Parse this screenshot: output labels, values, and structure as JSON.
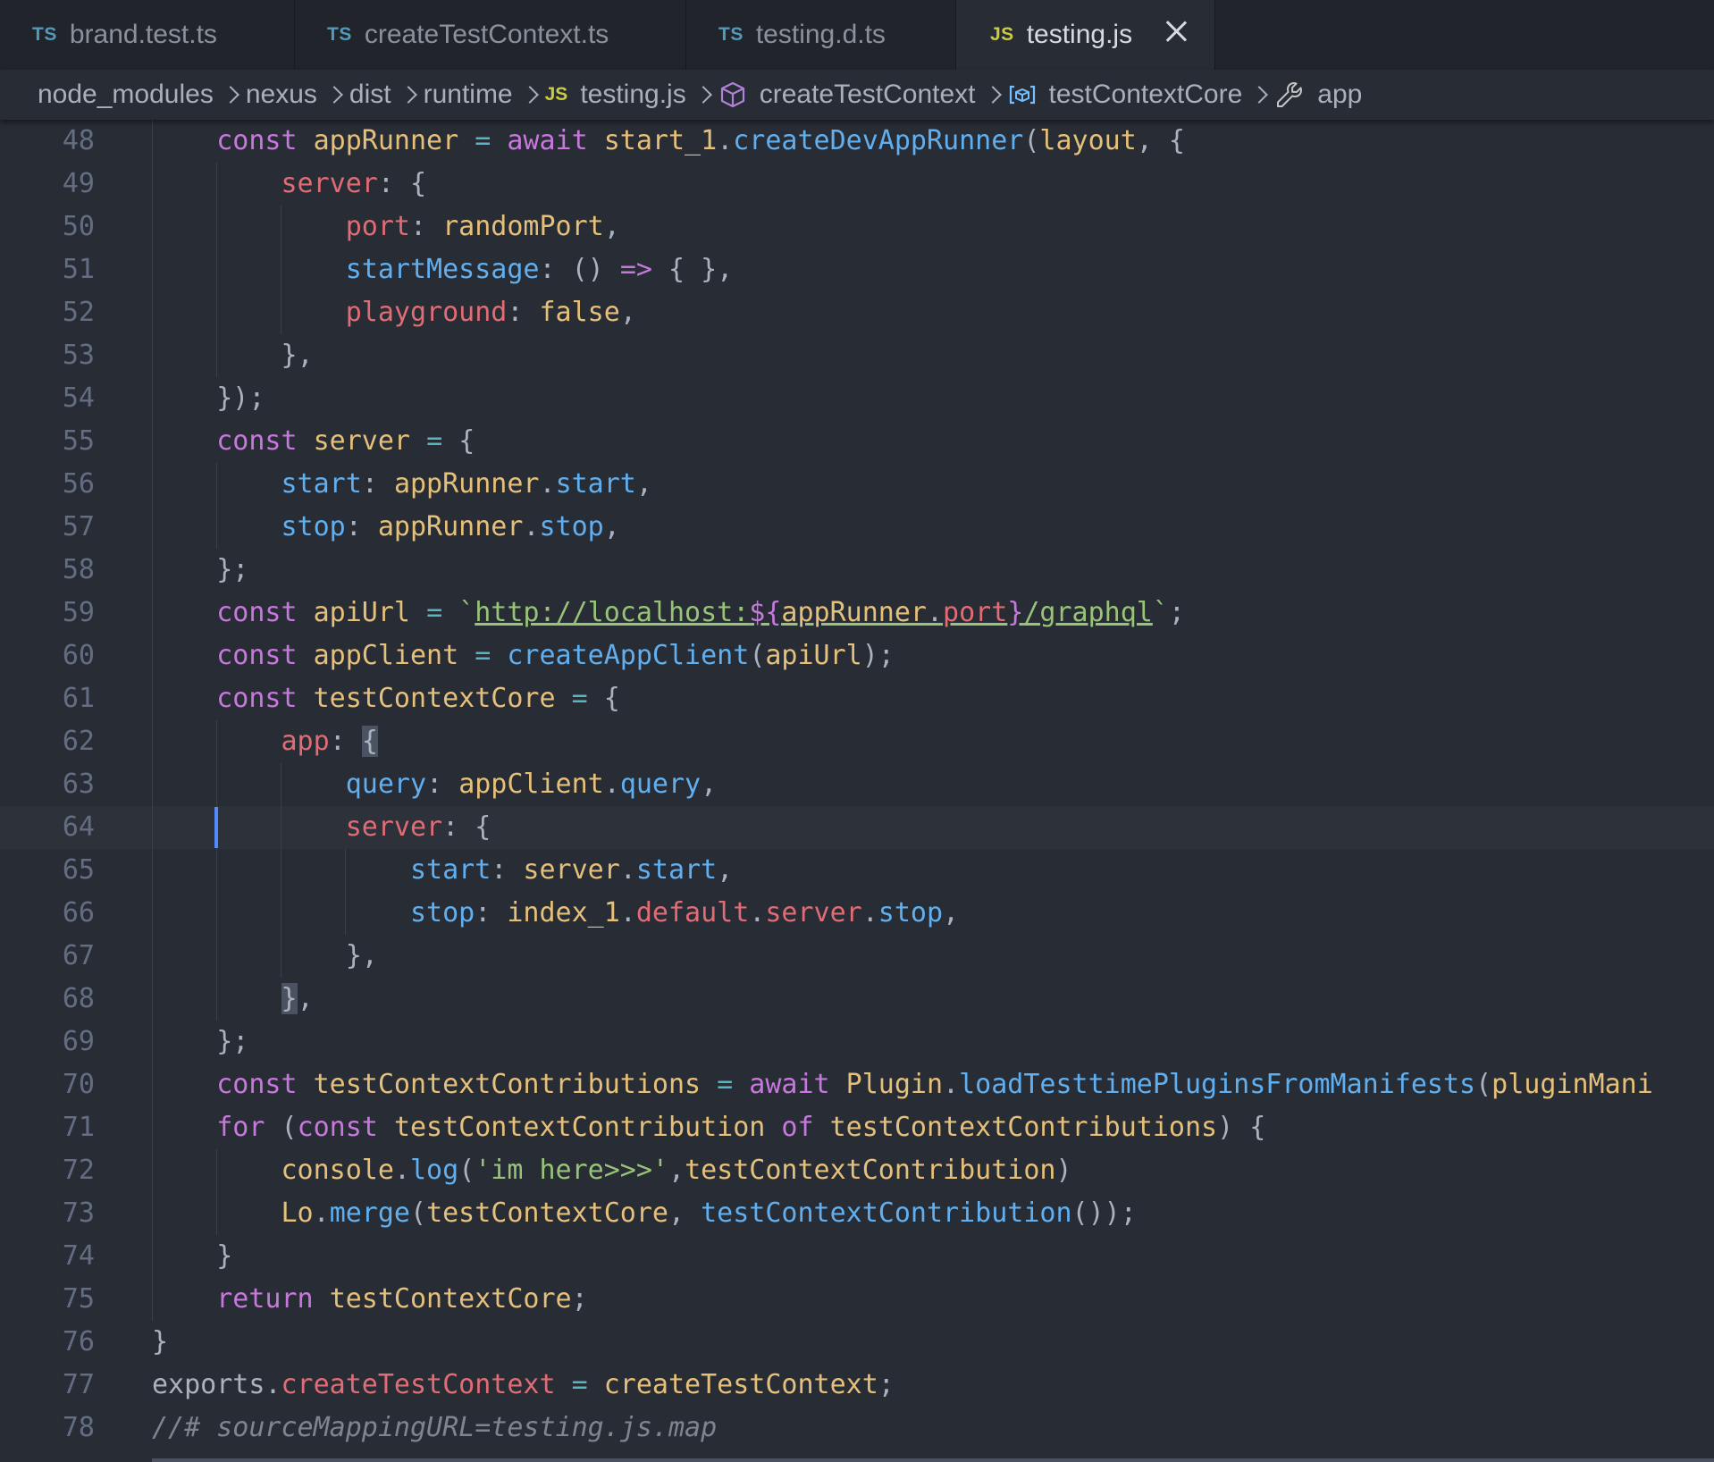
{
  "tabs": [
    {
      "type": "TS",
      "name": "brand.test.ts",
      "active": false
    },
    {
      "type": "TS",
      "name": "createTestContext.ts",
      "active": false
    },
    {
      "type": "TS",
      "name": "testing.d.ts",
      "active": false
    },
    {
      "type": "JS",
      "name": "testing.js",
      "active": true
    }
  ],
  "breadcrumb": {
    "items": [
      "node_modules",
      "nexus",
      "dist",
      "runtime",
      "testing.js",
      "createTestContext",
      "testContextCore",
      "app"
    ],
    "file_icon": "JS"
  },
  "editor": {
    "language": "javascript",
    "current_line": 64,
    "line_numbers": [
      "48",
      "49",
      "50",
      "51",
      "52",
      "53",
      "54",
      "55",
      "56",
      "57",
      "58",
      "59",
      "60",
      "61",
      "62",
      "63",
      "64",
      "65",
      "66",
      "67",
      "68",
      "69",
      "70",
      "71",
      "72",
      "73",
      "74",
      "75",
      "76",
      "77",
      "78"
    ],
    "lines": [
      "    const appRunner = await start_1.createDevAppRunner(layout, {",
      "        server: {",
      "            port: randomPort,",
      "            startMessage: () => { },",
      "            playground: false,",
      "        },",
      "    });",
      "    const server = {",
      "        start: appRunner.start,",
      "        stop: appRunner.stop,",
      "    };",
      "    const apiUrl = `http://localhost:${appRunner.port}/graphql`;",
      "    const appClient = createAppClient(apiUrl);",
      "    const testContextCore = {",
      "        app: {",
      "            query: appClient.query,",
      "            server: {",
      "                start: server.start,",
      "                stop: index_1.default.server.stop,",
      "            },",
      "        },",
      "    };",
      "    const testContextContributions = await Plugin.loadTesttimePluginsFromManifests(pluginMani",
      "    for (const testContextContribution of testContextContributions) {",
      "        console.log('im here>>>',testContextContribution)",
      "        Lo.merge(testContextCore, testContextContribution());",
      "    }",
      "    return testContextCore;",
      "}",
      "exports.createTestContext = createTestContext;",
      "//# sourceMappingURL=testing.js.map"
    ]
  },
  "colors": {
    "background": "#282c34",
    "tabbar": "#21252b",
    "keyword": "#c678dd",
    "variable": "#e5c07b",
    "function": "#61afef",
    "property": "#e06c75",
    "string": "#98c379",
    "comment": "#7f848e",
    "cursor": "#528bff"
  },
  "icons": {
    "ts_file": "ts-file-icon",
    "js_file": "js-file-icon",
    "close": "close-icon",
    "breadcrumb_sep": "chevron-right-icon",
    "symbol_function": "cube-icon",
    "symbol_variable": "variable-icon",
    "symbol_property": "wrench-icon"
  }
}
